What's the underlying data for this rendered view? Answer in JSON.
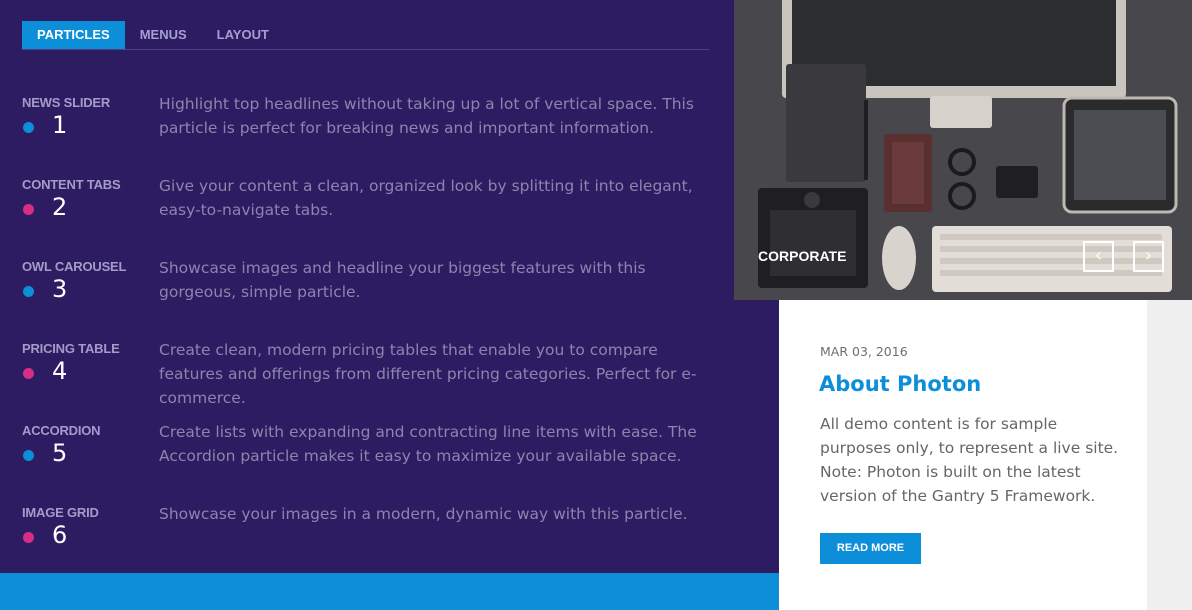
{
  "tabs": [
    {
      "label": "PARTICLES",
      "active": true
    },
    {
      "label": "MENUS",
      "active": false
    },
    {
      "label": "LAYOUT",
      "active": false
    }
  ],
  "items": [
    {
      "title": "NEWS SLIDER",
      "number": "1",
      "dot_color": "#0c8ed8",
      "desc": "Highlight top headlines without taking up a lot of vertical space. This particle is perfect for breaking news and important information."
    },
    {
      "title": "CONTENT TABS",
      "number": "2",
      "dot_color": "#d52e84",
      "desc": "Give your content a clean, organized look by splitting it into elegant, easy-to-navigate tabs."
    },
    {
      "title": "OWL CAROUSEL",
      "number": "3",
      "dot_color": "#0c8ed8",
      "desc": "Showcase images and headline your biggest features with this gorgeous, simple particle."
    },
    {
      "title": "PRICING TABLE",
      "number": "4",
      "dot_color": "#d52e84",
      "desc": "Create clean, modern pricing tables that enable you to compare features and offerings from different pricing categories. Perfect for e-commerce."
    },
    {
      "title": "ACCORDION",
      "number": "5",
      "dot_color": "#0c8ed8",
      "desc": "Create lists with expanding and contracting line items with ease. The Accordion particle makes it easy to maximize your available space."
    },
    {
      "title": "IMAGE GRID",
      "number": "6",
      "dot_color": "#d52e84",
      "desc": "Showcase your images in a modern, dynamic way with this particle."
    }
  ],
  "slider": {
    "label": "CORPORATE",
    "prev_icon": "chevron-left-icon",
    "next_icon": "chevron-right-icon",
    "prev_glyph": "‹",
    "next_glyph": "›"
  },
  "card": {
    "date": "MAR 03, 2016",
    "title": "About Photon",
    "body": "All demo content is for sample purposes only, to represent a live site. Note: Photon is built on the latest version of the Gantry 5 Framework.",
    "button": "READ MORE"
  },
  "colors": {
    "panel": "#2e1c63",
    "accent_blue": "#0c8ed8",
    "accent_pink": "#d52e84"
  }
}
